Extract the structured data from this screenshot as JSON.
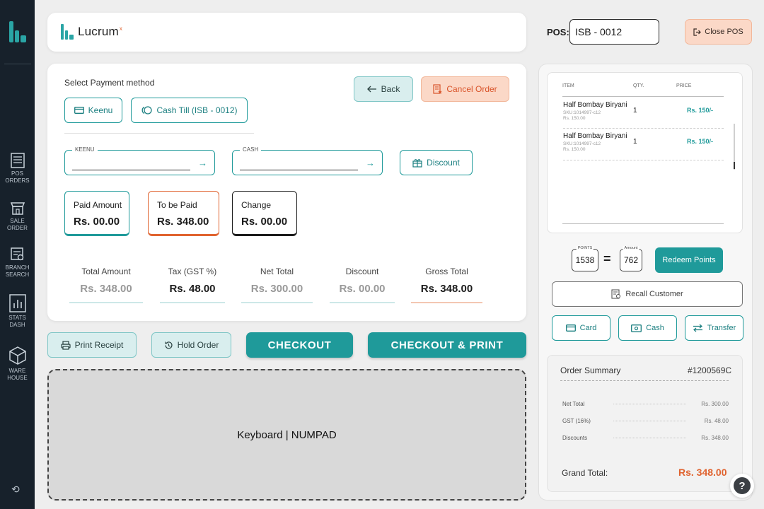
{
  "sidebar": {
    "items": [
      {
        "label_line1": "POS",
        "label_line2": "ORDERS",
        "icon": "pos-orders-icon"
      },
      {
        "label_line1": "SALE",
        "label_line2": "ORDER",
        "icon": "sale-order-icon"
      },
      {
        "label_line1": "BRANCH",
        "label_line2": "SEARCH",
        "icon": "branch-search-icon"
      },
      {
        "label_line1": "STATS",
        "label_line2": "DASH",
        "icon": "stats-dash-icon"
      },
      {
        "label_line1": "WARE",
        "label_line2": "HOUSE",
        "icon": "warehouse-icon"
      }
    ],
    "bottom_icon": "sync-icon"
  },
  "header": {
    "brand": "Lucrum",
    "brand_sup": "x",
    "pos_label": "POS:",
    "pos_value": "ISB - 0012",
    "close_label": "Close POS"
  },
  "payment": {
    "title": "Select Payment method",
    "methods": [
      "Keenu",
      "Cash Till (ISB - 0012)"
    ],
    "back_label": "Back",
    "cancel_label": "Cancel Order",
    "fields": [
      {
        "label": "KEENU"
      },
      {
        "label": "CASH"
      }
    ],
    "discount_label": "Discount",
    "amounts": [
      {
        "label": "Paid Amount",
        "value": "Rs. 00.00"
      },
      {
        "label": "To be Paid",
        "value": "Rs. 348.00"
      },
      {
        "label": "Change",
        "value": "Rs. 00.00"
      }
    ],
    "summary": [
      {
        "label": "Total Amount",
        "value": "Rs. 348.00"
      },
      {
        "label": "Tax (GST %)",
        "value": "Rs. 48.00"
      },
      {
        "label": "Net Total",
        "value": "Rs. 300.00"
      },
      {
        "label": "Discount",
        "value": "Rs. 00.00"
      },
      {
        "label": "Gross Total",
        "value": "Rs. 348.00"
      }
    ]
  },
  "actions": {
    "print_receipt": "Print Receipt",
    "hold_order": "Hold Order",
    "checkout": "CHECKOUT",
    "checkout_print": "CHECKOUT & PRINT"
  },
  "keyboard": {
    "label": "Keyboard | NUMPAD"
  },
  "cart": {
    "headers": {
      "item": "ITEM",
      "qty": "QTY.",
      "price": "PRICE"
    },
    "items": [
      {
        "name": "Half Bombay Biryani",
        "sku": "SKU:1014997-c12",
        "unit_price": "Rs. 150.00",
        "qty": "1",
        "price": "Rs. 150/-"
      },
      {
        "name": "Half Bombay Biryani",
        "sku": "SKU:1014997-c12",
        "unit_price": "Rs. 150.00",
        "qty": "1",
        "price": "Rs. 150/-"
      }
    ]
  },
  "points": {
    "points_label": "POINTS",
    "points_value": "1538",
    "equals": "=",
    "amount_label": "Amount",
    "amount_value": "762",
    "redeem_label": "Redeem Points"
  },
  "customer": {
    "recall_label": "Recall Customer"
  },
  "pay_options": [
    "Card",
    "Cash",
    "Transfer"
  ],
  "order_summary": {
    "title": "Order Summary",
    "order_id": "#1200569C",
    "rows": [
      {
        "label": "Net Total",
        "value": "Rs. 300.00"
      },
      {
        "label": "GST (16%)",
        "value": "Rs. 48.00"
      },
      {
        "label": "Discounts",
        "value": "Rs. 348.00"
      }
    ],
    "grand_label": "Grand Total:",
    "grand_value": "Rs. 348.00"
  },
  "help": {
    "label": "?"
  },
  "colors": {
    "accent": "#1f9a9a",
    "orange": "#e0632f",
    "sidebar": "#17212b",
    "soft_teal": "#d9eeee",
    "soft_orange": "#fbd8c7"
  }
}
